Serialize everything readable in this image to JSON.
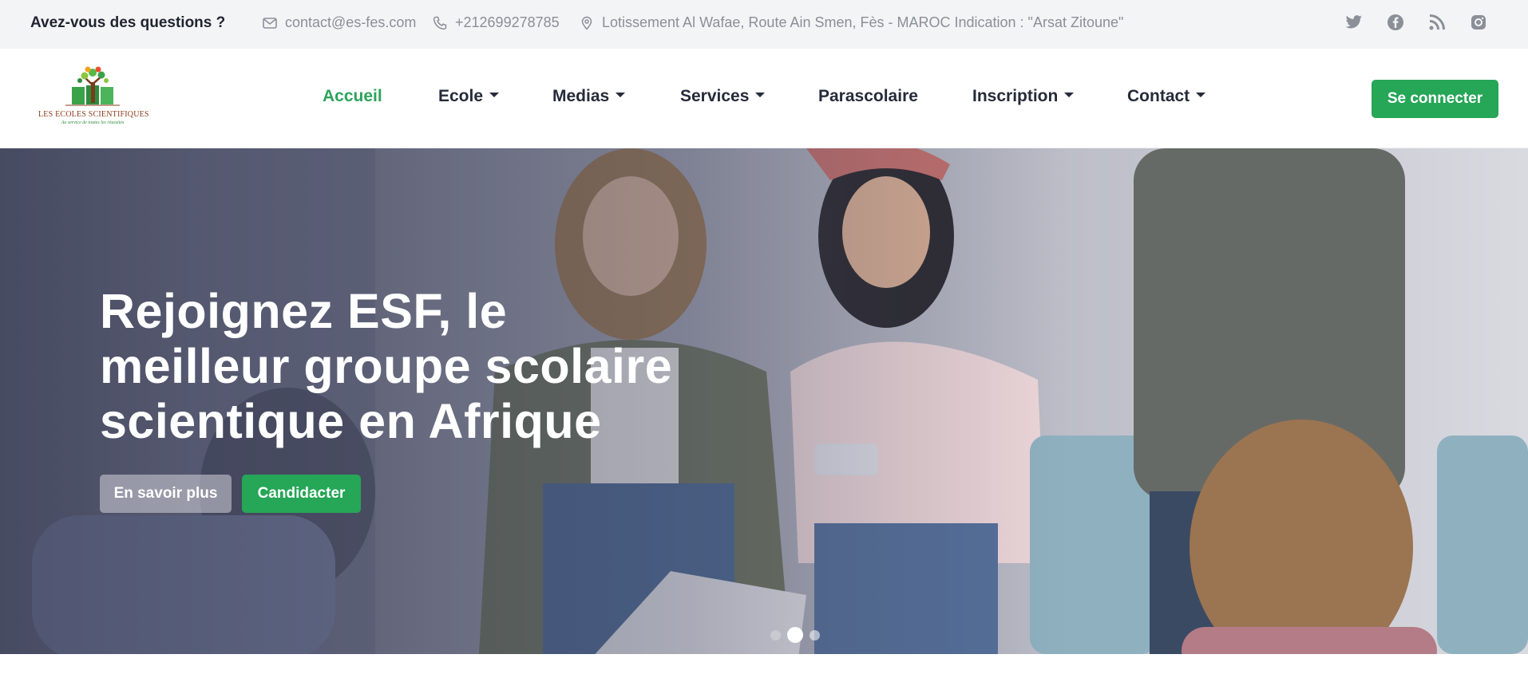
{
  "topbar": {
    "question": "Avez-vous des questions ?",
    "email": "contact@es-fes.com",
    "phone": "+212699278785",
    "address": "Lotissement Al Wafae, Route Ain Smen, Fès - MAROC Indication : \"Arsat Zitoune\"",
    "icons": {
      "email": "envelope-icon",
      "phone": "phone-icon",
      "address": "map-pin-icon"
    },
    "social": [
      "twitter-icon",
      "facebook-icon",
      "rss-icon",
      "instagram-icon"
    ]
  },
  "logo": {
    "title": "LES ECOLES SCIENTIFIQUES",
    "subtitle": "Au service de toutes les réussites"
  },
  "nav": {
    "items": [
      {
        "label": "Accueil",
        "active": true,
        "dropdown": false
      },
      {
        "label": "Ecole",
        "active": false,
        "dropdown": true
      },
      {
        "label": "Medias",
        "active": false,
        "dropdown": true
      },
      {
        "label": "Services",
        "active": false,
        "dropdown": true
      },
      {
        "label": "Parascolaire",
        "active": false,
        "dropdown": false
      },
      {
        "label": "Inscription",
        "active": false,
        "dropdown": true
      },
      {
        "label": "Contact",
        "active": false,
        "dropdown": true
      }
    ],
    "login_label": "Se connecter"
  },
  "hero": {
    "title": "Rejoignez ESF, le meilleur groupe scolaire scientique en Afrique",
    "more_label": "En savoir plus",
    "apply_label": "Candidacter",
    "carousel": {
      "slides": 3,
      "active_index": 1
    }
  },
  "colors": {
    "accent": "#26a657",
    "active_nav": "#2ea35b",
    "text_dark": "#262b3a",
    "muted": "#8a8f98",
    "topbar_bg": "#f3f4f6"
  }
}
